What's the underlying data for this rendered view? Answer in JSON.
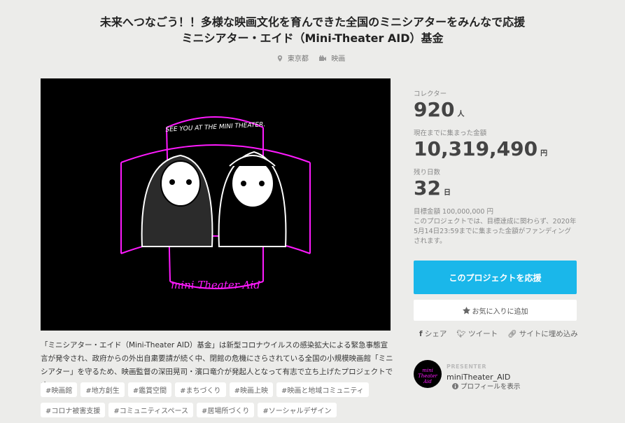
{
  "project": {
    "title_line1": "未来へつなごう！！多様な映画文化を育んできた全国のミニシアターをみんなで応援",
    "title_line2": "ミニシアター・エイド（Mini-Theater AID）基金",
    "location": "東京都",
    "category": "映画",
    "location_icon": "map-pin-icon",
    "category_icon": "film-icon"
  },
  "hero": {
    "top_text": "SEE YOU AT THE MINI THEATER.",
    "logo_text": "mini Theater Aid",
    "accent_color": "#ff1aff"
  },
  "description": "「ミニシアター・エイド（Mini-Theater AID）基金」は新型コロナウイルスの感染拡大による緊急事態宣言が発令され、政府からの外出自粛要請が続く中、閉館の危機にさらされている全国の小規模映画館「ミニシアター」を守るため、映画監督の深田晃司・濱口竜介が発起人となって有志で立ち上げたプロジェクトです。",
  "tags": [
    "#映画館",
    "#地方創生",
    "#鑑賞空間",
    "#まちづくり",
    "#映画上映",
    "#映画と地域コミュニティ",
    "#コロナ被害支援",
    "#コミュニティスペース",
    "#居場所づくり",
    "#ソーシャルデザイン"
  ],
  "stats": {
    "collector_label": "コレクター",
    "collector_value": "920",
    "collector_unit": "人",
    "amount_label": "現在までに集まった金額",
    "amount_value": "10,319,490",
    "amount_unit": "円",
    "days_label": "残り日数",
    "days_value": "32",
    "days_unit": "日",
    "goal": "目標金額 100,000,000 円",
    "note": "このプロジェクトでは、目標達成に関わらず、2020年5月14日23:59までに集まった金額がファンディングされます。"
  },
  "actions": {
    "back_label": "このプロジェクトを応援",
    "fav_label": "お気に入りに追加",
    "share_fb": "シェア",
    "share_tw": "ツイート",
    "share_embed": "サイトに埋め込み"
  },
  "presenter": {
    "label": "PRESENTER",
    "name": "miniTheater_AID",
    "profile_link": "プロフィールを表示"
  }
}
